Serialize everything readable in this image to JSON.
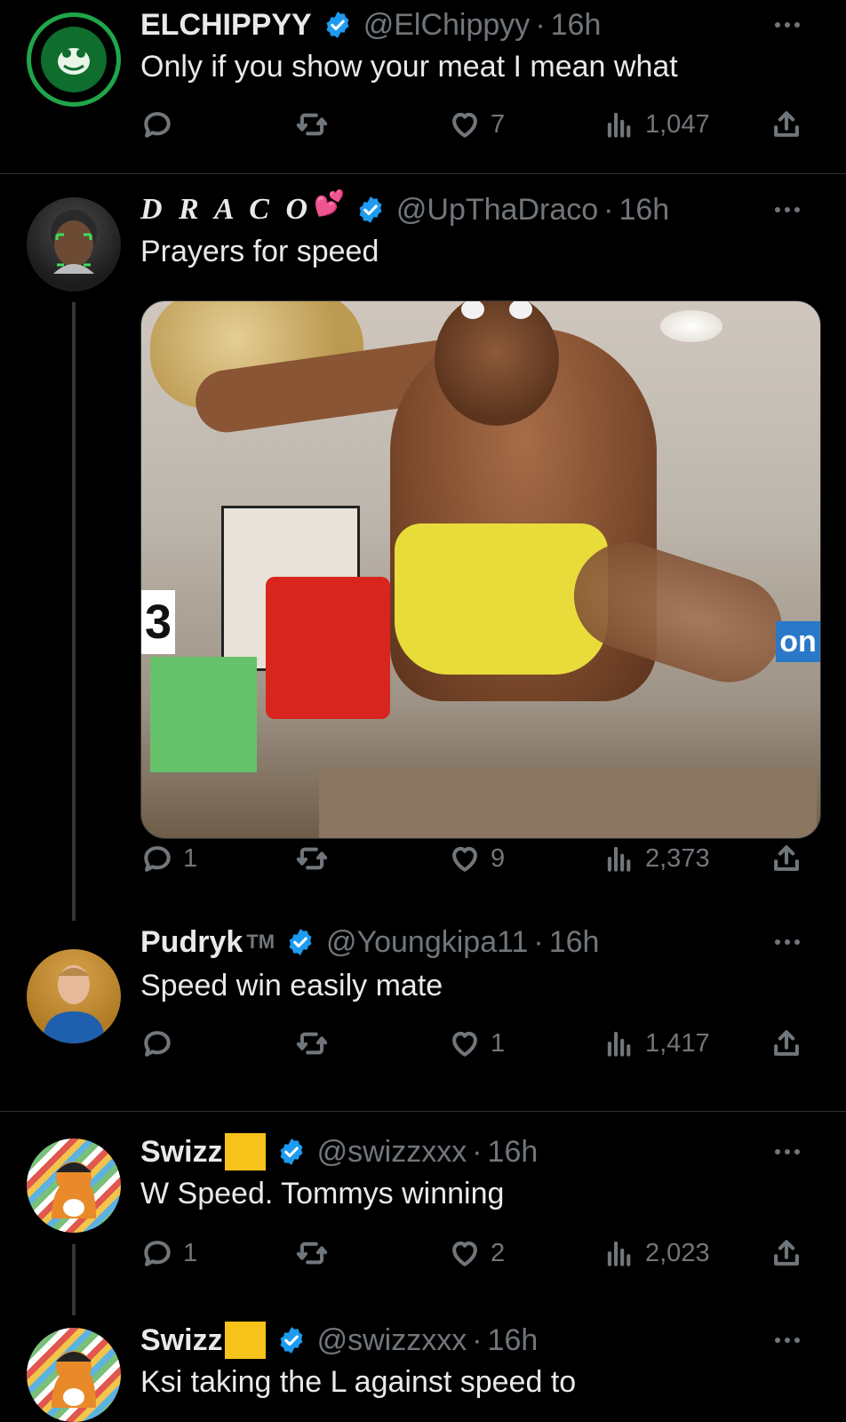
{
  "tweets": [
    {
      "name": "ELCHIPPYY",
      "handle": "@ElChippyy",
      "time": "16h",
      "text": "Only if you show your meat I mean what",
      "reply_count": "",
      "like_count": "7",
      "view_count": "1,047"
    },
    {
      "name": "D R A C O",
      "name_emoji": "💕",
      "handle": "@UpThaDraco",
      "time": "16h",
      "text": "Prayers for speed",
      "reply_count": "1",
      "like_count": "9",
      "view_count": "2,373",
      "media": {
        "number_tag": "3",
        "sign_text": "on"
      }
    },
    {
      "name": "Pudryk",
      "name_suffix": "TM",
      "handle": "@Youngkipa11",
      "time": "16h",
      "text": "Speed win easily mate",
      "reply_count": "",
      "like_count": "1",
      "view_count": "1,417"
    },
    {
      "name": "Swizz",
      "handle": "@swizzxxx",
      "time": "16h",
      "text": "W Speed. Tommys winning",
      "reply_count": "1",
      "like_count": "2",
      "view_count": "2,023"
    },
    {
      "name": "Swizz",
      "handle": "@swizzxxx",
      "time": "16h",
      "text": "Ksi taking the L against speed to"
    }
  ],
  "separator": "·",
  "icons": {
    "reply": "reply-icon",
    "retweet": "retweet-icon",
    "like": "heart-icon",
    "views": "views-icon",
    "share": "share-icon",
    "verified": "verified-badge-icon",
    "more": "more-options-icon"
  },
  "colors": {
    "background": "#000000",
    "text": "#e7e9ea",
    "muted": "#71767b",
    "verified": "#1d9bf0",
    "divider": "#2f3336",
    "avatar_ring": "#1fa64a"
  }
}
